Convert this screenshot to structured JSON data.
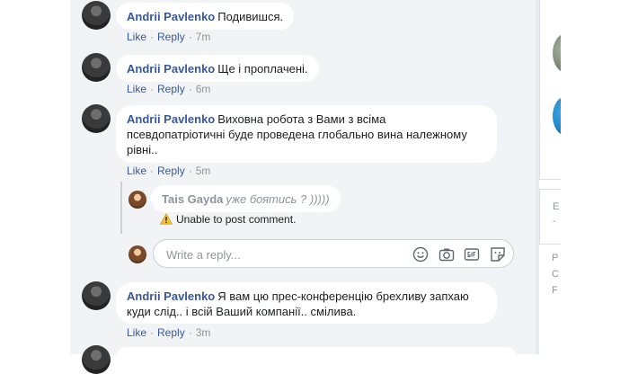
{
  "comments": [
    {
      "author": "Andrii Pavlenko",
      "text": "Подивишся.",
      "actions": {
        "like": "Like",
        "reply": "Reply",
        "time": "7m"
      }
    },
    {
      "author": "Andrii Pavlenko",
      "text": "Ще і проплачені.",
      "actions": {
        "like": "Like",
        "reply": "Reply",
        "time": "6m"
      }
    },
    {
      "author": "Andrii Pavlenko",
      "text_lines": [
        "Виховна робота з Вами з всіма",
        "псевдопатріотичні буде проведена глобально вина належному",
        "рівні.."
      ],
      "actions": {
        "like": "Like",
        "reply": "Reply",
        "time": "5m"
      }
    },
    {
      "author": "Andrii Pavlenko",
      "text_lines": [
        "Я вам цю прес-конференцію брехливу запхаю",
        "куди слід.. і всій Ваший компанії.. смілива."
      ],
      "actions": {
        "like": "Like",
        "reply": "Reply",
        "time": "3m"
      }
    }
  ],
  "reply": {
    "author": "Tais Gayda",
    "text": "уже боятись ? )))))",
    "error": "Unable to post comment."
  },
  "reply_input": {
    "placeholder": "Write a reply...",
    "icons": [
      "emoji-icon",
      "camera-icon",
      "gif-icon",
      "sticker-icon"
    ]
  },
  "right_column": {
    "fragments": [
      "E",
      "-",
      "P",
      "C",
      "F"
    ]
  },
  "colors": {
    "author": "#385898",
    "feed_bg": "#f2f3f5",
    "meta": "#90949c"
  }
}
